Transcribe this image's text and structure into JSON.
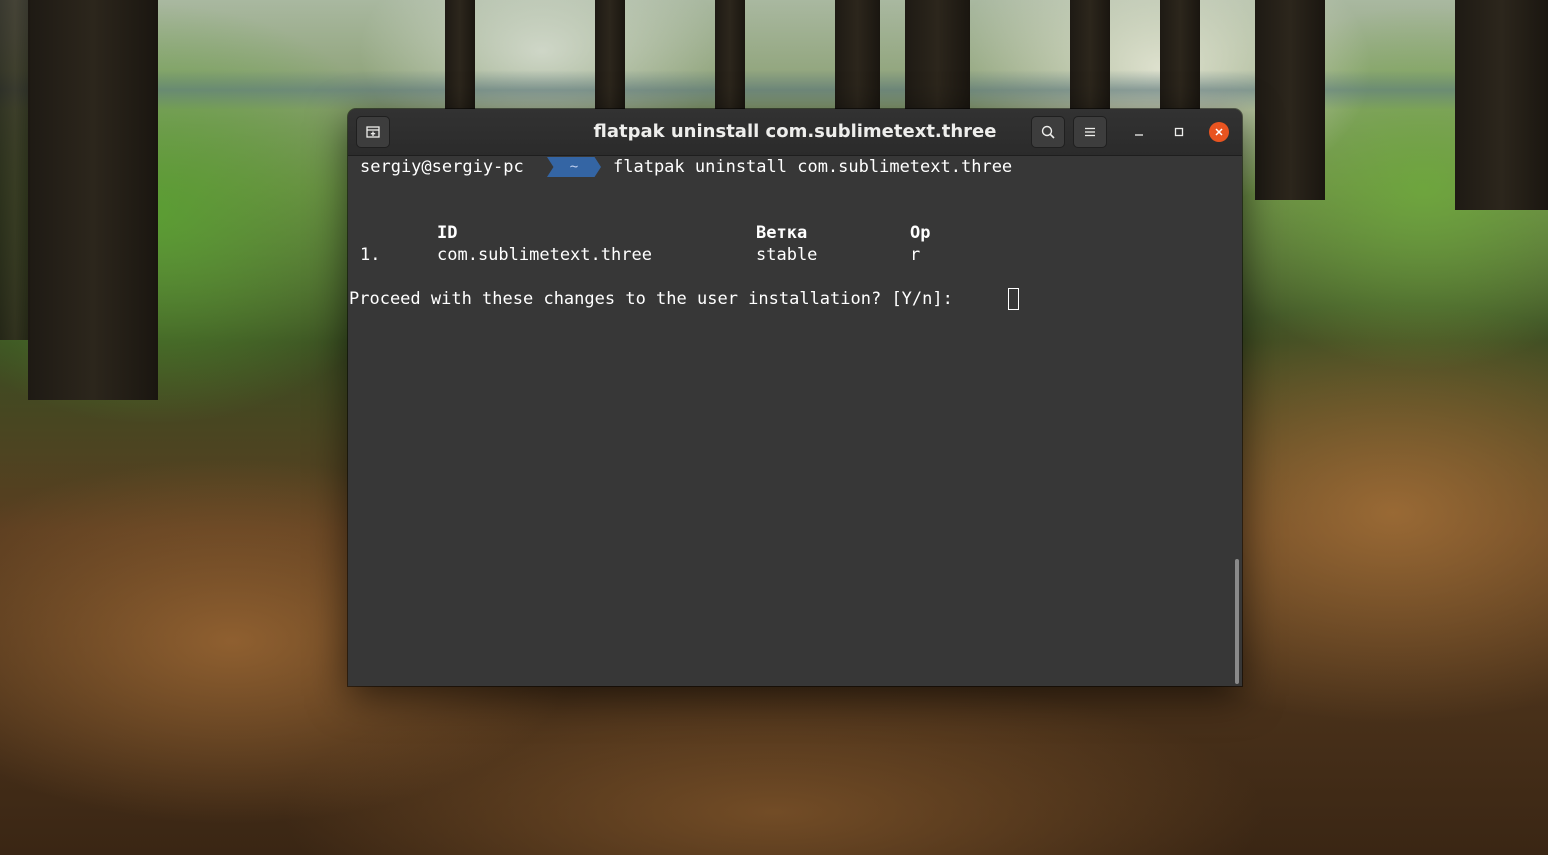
{
  "window": {
    "title": "flatpak uninstall com.sublimetext.three",
    "buttons": {
      "new_tab_icon": "new-tab-icon",
      "search_icon": "search-icon",
      "menu_icon": "hamburger-menu-icon",
      "minimize_label": "–",
      "maximize_label": "□",
      "close_label": "✕"
    }
  },
  "terminal": {
    "prompt_user": "sergiy@sergiy-pc",
    "prompt_dir": "~",
    "command": "flatpak uninstall com.sublimetext.three",
    "table": {
      "headers": {
        "id": "ID",
        "branch": "Ветка",
        "op": "Op"
      },
      "rows": [
        {
          "num": "1.",
          "id": "com.sublimetext.three",
          "branch": "stable",
          "op": "r"
        }
      ]
    },
    "question": "Proceed with these changes to the user installation? [Y/n]:"
  },
  "colors": {
    "accent_close": "#e95420",
    "prompt_dir_bg": "#3465a4",
    "terminal_bg": "#373737"
  }
}
